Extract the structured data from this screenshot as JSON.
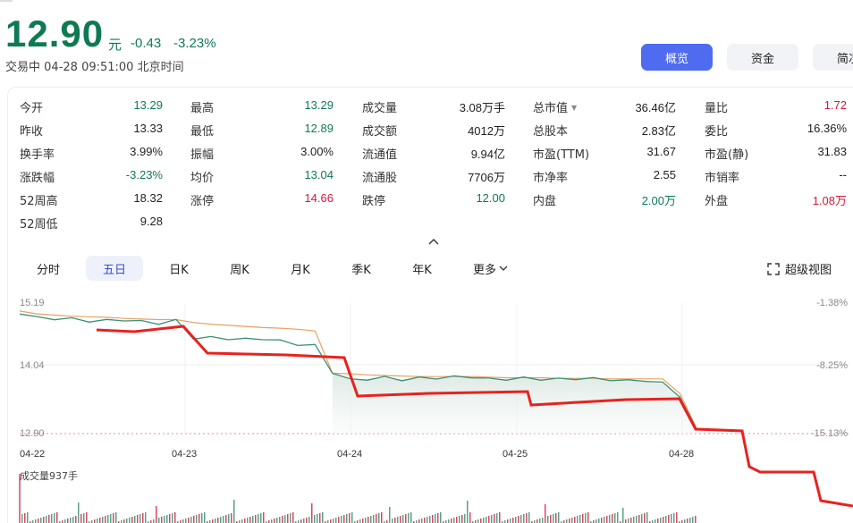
{
  "quote": {
    "price": "12.90",
    "unit": "元",
    "change": "-0.43",
    "change_pct": "-3.23%",
    "status": "交易中",
    "datetime": "04-28 09:51:00",
    "timezone": "北京时间"
  },
  "tabs": [
    "概览",
    "资金",
    "简况"
  ],
  "stats": [
    [
      {
        "label": "今开",
        "value": "13.29",
        "color": "green"
      },
      {
        "label": "最高",
        "value": "13.29",
        "color": "green"
      },
      {
        "label": "成交量",
        "value": "3.08万手",
        "color": "black"
      },
      {
        "label": "总市值",
        "value": "36.46亿",
        "color": "black",
        "dropdown": true
      },
      {
        "label": "量比",
        "value": "1.72",
        "color": "red"
      }
    ],
    [
      {
        "label": "昨收",
        "value": "13.33",
        "color": "black"
      },
      {
        "label": "最低",
        "value": "12.89",
        "color": "green"
      },
      {
        "label": "成交额",
        "value": "4012万",
        "color": "black"
      },
      {
        "label": "总股本",
        "value": "2.83亿",
        "color": "black"
      },
      {
        "label": "委比",
        "value": "16.36%",
        "color": "black"
      }
    ],
    [
      {
        "label": "换手率",
        "value": "3.99%",
        "color": "black"
      },
      {
        "label": "振幅",
        "value": "3.00%",
        "color": "black"
      },
      {
        "label": "流通值",
        "value": "9.94亿",
        "color": "black"
      },
      {
        "label": "市盈(TTM)",
        "value": "31.67",
        "color": "black"
      },
      {
        "label": "市盈(静)",
        "value": "31.83",
        "color": "black"
      }
    ],
    [
      {
        "label": "涨跌幅",
        "value": "-3.23%",
        "color": "green"
      },
      {
        "label": "均价",
        "value": "13.04",
        "color": "green"
      },
      {
        "label": "流通股",
        "value": "7706万",
        "color": "black"
      },
      {
        "label": "市净率",
        "value": "2.55",
        "color": "black"
      },
      {
        "label": "市销率",
        "value": "--",
        "color": "black"
      }
    ],
    [
      {
        "label": "52周高",
        "value": "18.32",
        "color": "black"
      },
      {
        "label": "涨停",
        "value": "14.66",
        "color": "red"
      },
      {
        "label": "跌停",
        "value": "12.00",
        "color": "green"
      },
      {
        "label": "内盘",
        "value": "2.00万",
        "color": "green"
      },
      {
        "label": "外盘",
        "value": "1.08万",
        "color": "red"
      }
    ],
    [
      {
        "label": "52周低",
        "value": "9.28",
        "color": "black"
      }
    ]
  ],
  "period_tabs": [
    "分时",
    "五日",
    "日K",
    "周K",
    "月K",
    "季K",
    "年K",
    "更多"
  ],
  "active_period": "五日",
  "fullscreen_label": "超级视图",
  "colors": {
    "green": "#0e7a53",
    "red": "#d6183b",
    "accent": "#4f6bf0"
  },
  "chart_data": {
    "type": "line",
    "y_ticks_left": [
      "15.19",
      "14.04",
      "12.90"
    ],
    "y_ticks_right": [
      "-1.38%",
      "-8.25%",
      "-15.13%"
    ],
    "ylim": [
      12.9,
      15.19
    ],
    "x_labels": [
      "04-22",
      "04-23",
      "04-24",
      "04-25",
      "04-28"
    ],
    "volume_label": "成交量937手",
    "series": [
      {
        "values": [
          15.02,
          14.93,
          14.92,
          14.91,
          14.88,
          14.88,
          14.9,
          14.86,
          14.84,
          14.88,
          14.58,
          14.58,
          14.57,
          14.55,
          14.57,
          14.52,
          14.47,
          14.44,
          13.98,
          13.84,
          13.86,
          13.88,
          13.85,
          13.87,
          13.88,
          13.89,
          13.9,
          13.85,
          13.86,
          13.87,
          13.86,
          13.85,
          13.87,
          13.86,
          13.85,
          13.82,
          13.84,
          13.78,
          13.56,
          12.93
        ]
      },
      {
        "values": [
          15.05,
          15.0,
          14.98,
          14.96,
          14.95,
          14.94,
          14.92,
          14.91,
          14.9,
          14.9,
          14.85,
          14.82,
          14.8,
          14.78,
          14.76,
          14.75,
          14.73,
          14.7,
          13.96,
          13.95,
          13.93,
          13.92,
          13.91,
          13.9,
          13.9,
          13.9,
          13.9,
          13.89,
          13.88,
          13.88,
          13.88,
          13.87,
          13.87,
          13.87,
          13.86,
          13.86,
          13.86,
          13.86,
          13.6,
          12.96
        ]
      }
    ]
  }
}
